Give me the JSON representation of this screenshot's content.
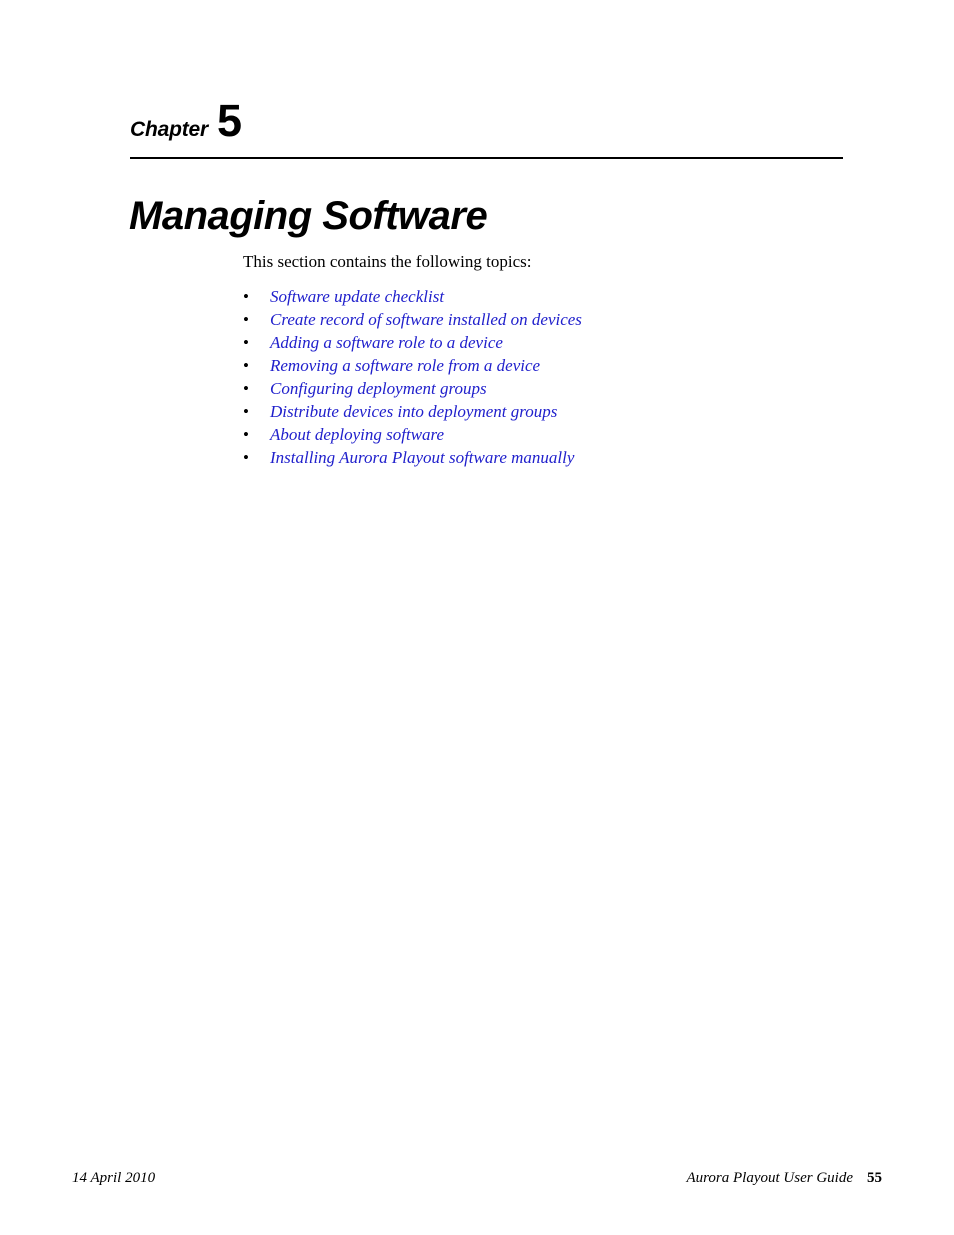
{
  "chapter": {
    "label": "Chapter",
    "number": "5",
    "title": "Managing Software"
  },
  "body": {
    "intro": "This section contains the following topics:",
    "bullet_glyph": "•",
    "link_color": "#2020cc",
    "topics": [
      {
        "label": "Software update checklist"
      },
      {
        "label": "Create record of software installed on devices"
      },
      {
        "label": "Adding a software role to a device"
      },
      {
        "label": "Removing a software role from a device"
      },
      {
        "label": "Configuring deployment groups"
      },
      {
        "label": "Distribute devices into deployment groups"
      },
      {
        "label": "About deploying software"
      },
      {
        "label": "Installing Aurora Playout software manually"
      }
    ]
  },
  "footer": {
    "date": "14  April  2010",
    "guide_title": "Aurora Playout User Guide",
    "page_number": "55"
  }
}
